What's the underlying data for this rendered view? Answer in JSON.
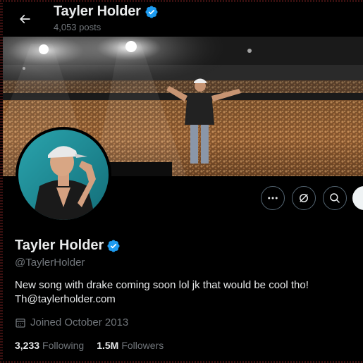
{
  "header": {
    "title": "Tayler Holder",
    "posts_count": "4,053 posts"
  },
  "profile": {
    "name": "Tayler Holder",
    "handle": "@TaylerHolder",
    "bio_line1": "New song with drake coming soon lol jk that would be cool tho!",
    "bio_line2": "Th@taylerholder.com",
    "joined": "Joined October 2013",
    "following_count": "3,233",
    "following_label": "Following",
    "followers_count": "1.5M",
    "followers_label": "Followers",
    "verified_color": "#1d9bf0"
  },
  "actions": {
    "more_icon": "more-horizontal-icon",
    "grok_icon": "grok-icon",
    "search_icon": "search-icon"
  }
}
